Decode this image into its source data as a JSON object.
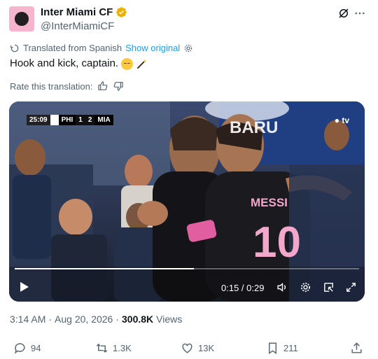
{
  "author": {
    "display_name": "Inter Miami CF",
    "handle": "@InterMiamiCF",
    "verified_color": "#e8b100",
    "avatar_color": "#f5b6cd"
  },
  "translation": {
    "label": "Translated from Spanish",
    "show_original": "Show original"
  },
  "tweet": {
    "text": "Hook and kick, captain.",
    "emojis": [
      "pensive-face",
      "magic-wand"
    ]
  },
  "rate": {
    "label": "Rate this translation:"
  },
  "video": {
    "scorebug": {
      "clock": "25:09",
      "home": "PHI",
      "home_score": "1",
      "away_score": "2",
      "away": "MIA"
    },
    "watermark": "tv",
    "current_time": "0:15",
    "duration": "0:29",
    "time_display": "0:15 / 0:29",
    "progress_fraction": 0.52
  },
  "meta": {
    "time": "3:14 AM",
    "separator": "·",
    "date": "Aug 20, 2026",
    "views_count": "300.8K",
    "views_label": "Views"
  },
  "actions": {
    "replies": "94",
    "reposts": "1.3K",
    "likes": "13K",
    "bookmarks": "211"
  },
  "colors": {
    "link": "#1d9bf0",
    "muted": "#536471",
    "text": "#0f1419"
  }
}
